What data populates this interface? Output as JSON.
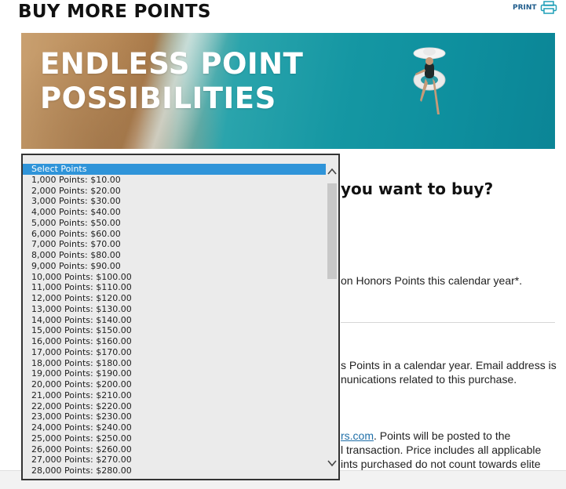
{
  "page": {
    "title": "BUY MORE POINTS",
    "print_label": "PRINT"
  },
  "hero": {
    "line1": "ENDLESS POINT",
    "line2": "POSSIBILITIES"
  },
  "content": {
    "question": "you want to buy?",
    "limit_text": "on Honors Points this calendar year*.",
    "email_line1": "s Points in a calendar year. Email address is",
    "email_line2": "nunications related to this purchase.",
    "link_text": "rs.com",
    "posting_text": ". Points will be posted to the",
    "transaction_text": "l transaction. Price includes all applicable",
    "elite_text": "ints purchased do not count towards elite"
  },
  "dropdown": {
    "options": [
      "Select Points",
      "1,000 Points: $10.00",
      "2,000 Points: $20.00",
      "3,000 Points: $30.00",
      "4,000 Points: $40.00",
      "5,000 Points: $50.00",
      "6,000 Points: $60.00",
      "7,000 Points: $70.00",
      "8,000 Points: $80.00",
      "9,000 Points: $90.00",
      "10,000 Points: $100.00",
      "11,000 Points: $110.00",
      "12,000 Points: $120.00",
      "13,000 Points: $130.00",
      "14,000 Points: $140.00",
      "15,000 Points: $150.00",
      "16,000 Points: $160.00",
      "17,000 Points: $170.00",
      "18,000 Points: $180.00",
      "19,000 Points: $190.00",
      "20,000 Points: $200.00",
      "21,000 Points: $210.00",
      "22,000 Points: $220.00",
      "23,000 Points: $230.00",
      "24,000 Points: $240.00",
      "25,000 Points: $250.00",
      "26,000 Points: $260.00",
      "27,000 Points: $270.00",
      "28,000 Points: $280.00"
    ],
    "selected_index": 0,
    "colors": {
      "highlight": "#2f94d9",
      "background": "#ebebeb"
    }
  },
  "icons": {
    "print": "printer-icon",
    "scroll_up": "chevron-up-icon",
    "scroll_down": "chevron-down-icon"
  }
}
